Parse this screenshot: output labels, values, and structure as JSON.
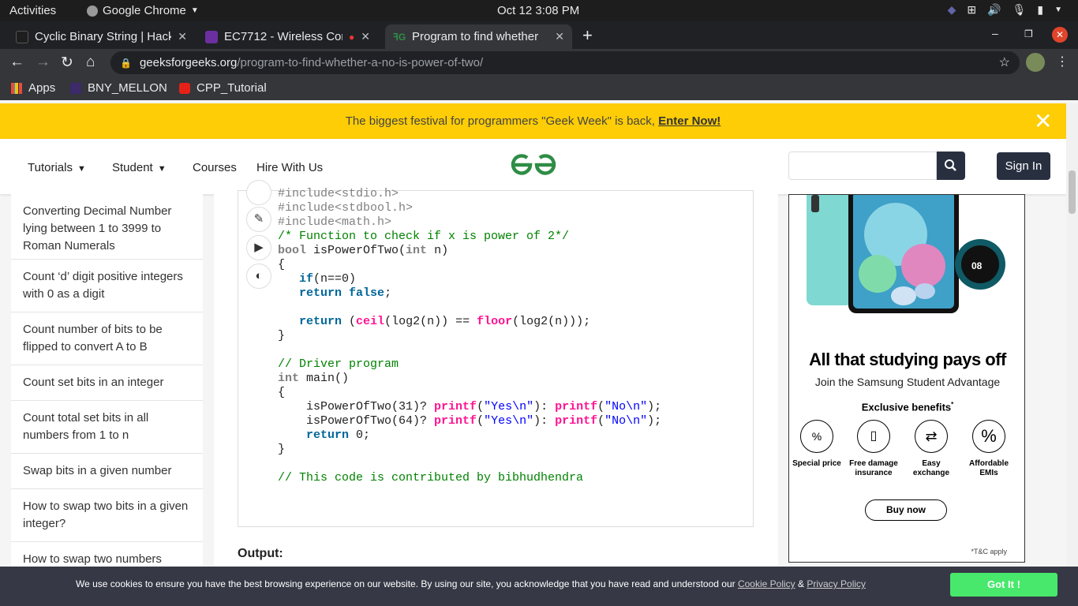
{
  "os_bar": {
    "activities": "Activities",
    "app_name": "Google Chrome",
    "clock": "Oct 12  3:08 PM"
  },
  "tabs": [
    {
      "title": "Cyclic Binary String | Hack",
      "favicon_color": "#1e1e1e"
    },
    {
      "title": "EC7712 - Wireless Com",
      "favicon_color": "#6b2fa0"
    },
    {
      "title": "Program to find whether",
      "favicon_color": "#2f8d46"
    }
  ],
  "address_bar": {
    "host": "geeksforgeeks.org",
    "path": "/program-to-find-whether-a-no-is-power-of-two/"
  },
  "bookmarks": [
    {
      "label": "Apps"
    },
    {
      "label": "BNY_MELLON"
    },
    {
      "label": "CPP_Tutorial"
    }
  ],
  "banner": {
    "text": "The biggest festival for programmers \"Geek Week\" is back, ",
    "link": "Enter Now!"
  },
  "site_nav": {
    "tutorials": "Tutorials",
    "student": "Student",
    "courses": "Courses",
    "hire": "Hire With Us",
    "sign_in": "Sign In",
    "brand_color": "#2f8d46"
  },
  "sidebar": {
    "items": [
      "Converting Decimal Number lying between 1 to 3999 to Roman Numerals",
      "Count ‘d’ digit positive integers with 0 as a digit",
      "Count number of bits to be flipped to convert A to B",
      "Count set bits in an integer",
      "Count total set bits in all numbers from 1 to n",
      "Swap bits in a given number",
      "How to swap two bits in a given integer?",
      "How to swap two numbers"
    ]
  },
  "code": {
    "lines": [
      "#include<stdio.h>",
      "#include<stdbool.h>",
      "#include<math.h>",
      "",
      "/* Function to check if x is power of 2*/",
      "bool isPowerOfTwo(int n)",
      "{",
      "   if(n==0)",
      "   return false;",
      "",
      "   return (ceil(log2(n)) == floor(log2(n)));",
      "}",
      "",
      "// Driver program",
      "int main()",
      "{",
      "    isPowerOfTwo(31)? printf(\"Yes\\n\"): printf(\"No\\n\");",
      "    isPowerOfTwo(64)? printf(\"Yes\\n\"): printf(\"No\\n\");",
      "    return 0;",
      "}",
      "",
      "// This code is contributed by bibhudhendra"
    ]
  },
  "output_label": "Output:",
  "ad": {
    "headline": "All that studying pays off",
    "subheadline": "Join the Samsung Student Advantage",
    "benefits_title": "Exclusive benefits",
    "benefits": [
      {
        "label": "Special price",
        "icon": "price-tag-icon"
      },
      {
        "label": "Free damage insurance",
        "icon": "phone-hand-icon"
      },
      {
        "label": "Easy exchange",
        "icon": "exchange-icon"
      },
      {
        "label": "Affordable EMIs",
        "icon": "percent-icon"
      }
    ],
    "cta": "Buy now",
    "disclaimer": "*T&C apply",
    "watch_time": "08"
  },
  "cookie": {
    "message": "We use cookies to ensure you have the best browsing experience on our website. By using our site, you acknowledge that you have read and understood our ",
    "cookie_policy": "Cookie Policy",
    "amp": " & ",
    "privacy_policy": "Privacy Policy",
    "accept": "Got It !"
  }
}
